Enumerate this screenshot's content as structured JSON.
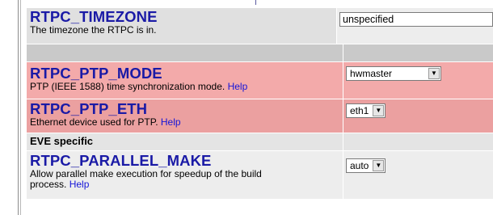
{
  "settings": [
    {
      "name": "RTPC_TIMEZONE",
      "description": "The timezone the RTPC is in.",
      "control": "text",
      "value": "unspecified"
    },
    {
      "name": "RTPC_PTP_MODE",
      "description": "PTP (IEEE 1588) time synchronization mode.",
      "help_label": "Help",
      "control": "select",
      "value": "hwmaster"
    },
    {
      "name": "RTPC_PTP_ETH",
      "description": "Ethernet device used for PTP.",
      "help_label": "Help",
      "control": "select",
      "value": "eth1"
    },
    {
      "name": "RTPC_PARALLEL_MAKE",
      "description_line1": "Allow parallel make execution for speedup of the build",
      "description_line2": "process.",
      "help_label": "Help",
      "control": "select",
      "value": "auto"
    }
  ],
  "section_header": "EVE specific",
  "icons": {
    "dropdown": "chevron-down-icon"
  },
  "colors": {
    "name_text": "#1a1aa6",
    "help_link": "#1515d8",
    "highlight_row": "#f3aaaa",
    "gray_row": "#e0e0e0"
  }
}
